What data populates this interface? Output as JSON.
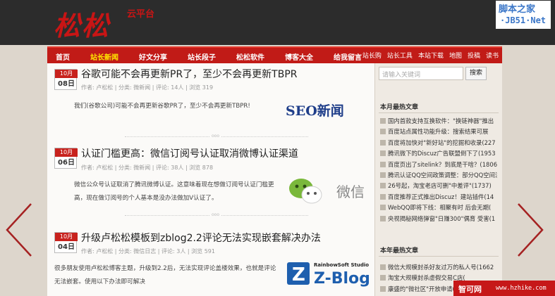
{
  "header": {
    "logo": "松松",
    "logo_sub": "云平台",
    "watermark_top": {
      "line1": "脚本之家",
      "line2": "·JB51·Net"
    }
  },
  "nav": {
    "main": [
      "首页",
      "站长新闻",
      "好文分享",
      "站长段子",
      "松松软件",
      "博客大全",
      "给我留言"
    ],
    "active": "站长新闻",
    "right": [
      "站长购",
      "站长工具",
      "本站下载",
      "地图",
      "投稿",
      "读书"
    ]
  },
  "posts": [
    {
      "month": "10月",
      "day": "08日",
      "title": "谷歌可能不会再更新PR了，至少不会再更新TBPR",
      "meta": "作者: 卢松松 | 分类: 微新闻 | 评论: 14人 | 浏览 319",
      "excerpt": "我们(谷歌公司)可能不会再更新谷歌PR了，至少不会再更新TBPR!",
      "image_text": "SEO新闻"
    },
    {
      "month": "10月",
      "day": "06日",
      "title": "认证门槛更高：微信订阅号认证取消微博认证渠道",
      "meta": "作者: 卢松松 | 分类: 微新闻 | 评论: 38人 | 浏览 878",
      "excerpt": "微信公众号认证取消了腾讯微博认证。这意味着现在想做订阅号认证门槛更高，现在做订阅号的个人基本是没办法做加V认证了。",
      "image_text": "微信"
    },
    {
      "month": "10月",
      "day": "04日",
      "title": "升级卢松松模板到zblog2.2评论无法实现嵌套解决办法",
      "meta": "作者: 卢松松 | 分类: 微信日志 | 评论: 3人 | 浏览 591",
      "excerpt": "很多朋友使用卢松松博客主题，升级到2.2后，无法实现评论盖楼效果，也就是评论无法嵌套。使用以下办法即可解决",
      "image_text": "Z-Blog",
      "image_subtext": "RainbowSoft Studio"
    }
  ],
  "separator": "ooo",
  "sidebar": {
    "search_placeholder": "请输入关键词",
    "search_button": "搜索",
    "section1_title": "本月最热文章",
    "section1": [
      "国内首款支持互换软件：\"换链神器\"推出",
      "百度站点属性功能升级：搜索结果可展",
      "百度将加快对\"新好站\"的挖掘和收录(227",
      "腾讯微下的Discuz广告联盟倒下了(1953",
      "百度页出了sitelink？到底是干啥？(1806",
      "腾讯认证QQ空间政策调整：部分QQ空间流",
      "26号起，淘宝老店可删\"中差评\"(1737)",
      "百度推荐正式推出Discuz！建站插件(14",
      "WebQQ即将下线：相聚有时 后会无期(",
      "央视揭秘网络弹窗\"日赚300\"偶育 受害(1"
    ],
    "section2_title": "本年最热文章",
    "section2": [
      "微信大规模封杀好友过万的私人号(1662",
      "淘宝大规模封杀虚假交易C店(",
      "康盛的\"微社区\"开放申请("
    ]
  },
  "watermark_bottom": {
    "brand": "智可网",
    "url": "www.hzhike.com"
  }
}
